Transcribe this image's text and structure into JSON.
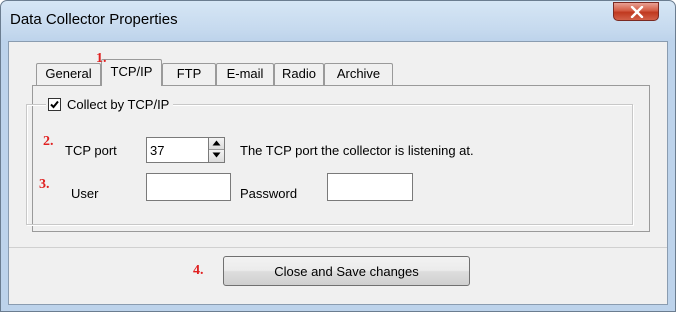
{
  "window": {
    "title": "Data Collector Properties"
  },
  "tabs": [
    {
      "label": "General",
      "active": false
    },
    {
      "label": "TCP/IP",
      "active": true
    },
    {
      "label": "FTP",
      "active": false
    },
    {
      "label": "E-mail",
      "active": false
    },
    {
      "label": "Radio",
      "active": false
    },
    {
      "label": "Archive",
      "active": false
    }
  ],
  "annotations": {
    "one": "1.",
    "two": "2.",
    "three": "3.",
    "four": "4."
  },
  "tcpip": {
    "collect_label": "Collect by TCP/IP",
    "collect_checked": true,
    "port_label": "TCP port",
    "port_value": "37",
    "port_description": "The TCP port the collector is listening at.",
    "user_label": "User",
    "user_value": "",
    "password_label": "Password",
    "password_value": ""
  },
  "actions": {
    "close_save_label": "Close and Save changes"
  },
  "colors": {
    "annotation": "#e02020",
    "close_button": "#c0391f"
  },
  "icons": {
    "close": "close-icon",
    "check": "checkmark-icon",
    "spin_up": "spin-up-icon",
    "spin_down": "spin-down-icon"
  }
}
